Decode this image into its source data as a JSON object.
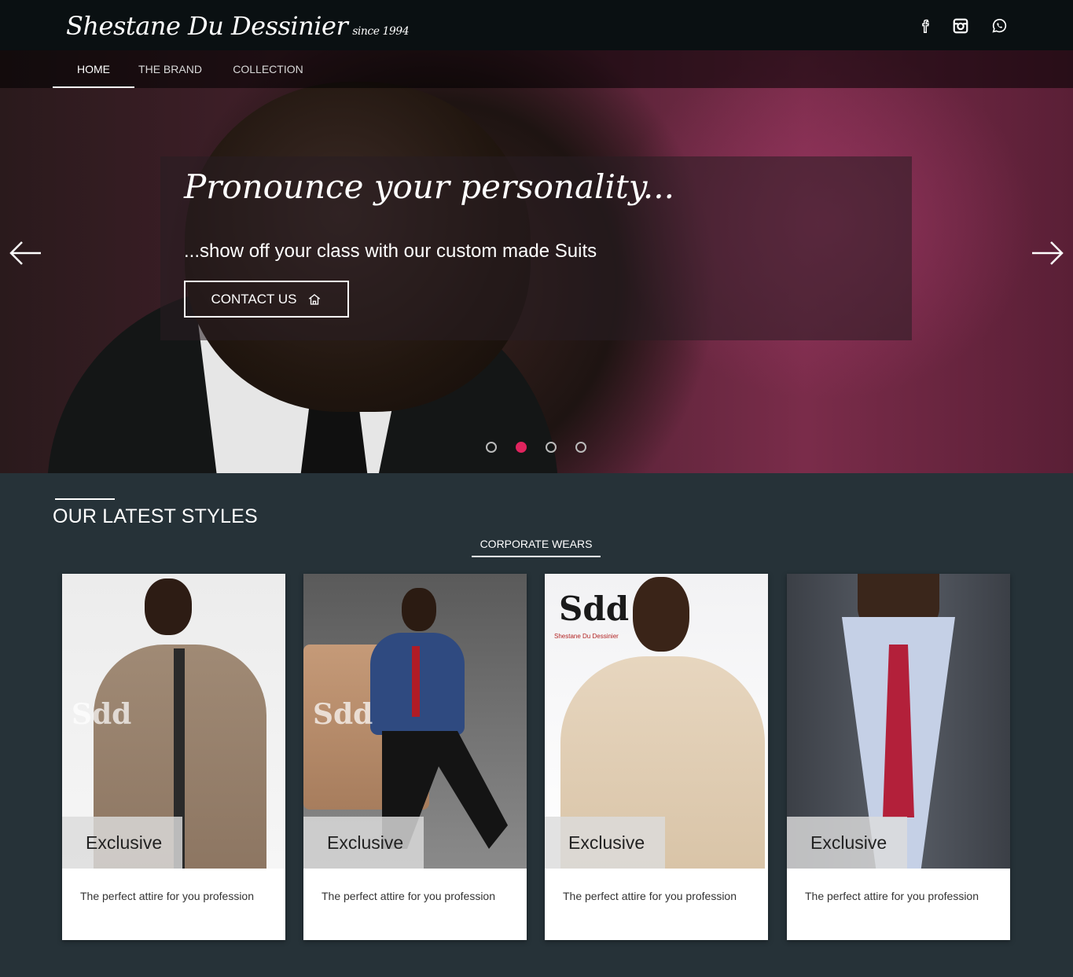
{
  "brand": {
    "name": "Shestane Du Dessinier",
    "since": "since 1994"
  },
  "social": {
    "icons": [
      "facebook-icon",
      "instagram-icon",
      "whatsapp-icon"
    ]
  },
  "nav": {
    "items": [
      "HOME",
      "THE BRAND",
      "COLLECTION"
    ],
    "active": "HOME"
  },
  "hero": {
    "title": "Pronounce your personality...",
    "subtitle": "...show off your class with our custom made Suits",
    "button_label": "CONTACT US",
    "slides": 4,
    "active_slide": 2
  },
  "section": {
    "title": "OUR LATEST STYLES",
    "tab_label": "CORPORATE WEARS"
  },
  "cards": [
    {
      "badge": "Exclusive",
      "description": "The perfect attire for you profession"
    },
    {
      "badge": "Exclusive",
      "description": "The perfect attire for you profession"
    },
    {
      "badge": "Exclusive",
      "description": "The perfect attire for you profession"
    },
    {
      "badge": "Exclusive",
      "description": "The perfect attire for you profession"
    }
  ],
  "card_logo": {
    "mark": "Sdd",
    "name": "Shestane Du Dessinier"
  },
  "colors": {
    "accent": "#e0245e",
    "topbar": "#0a1012",
    "section_bg": "#263238"
  }
}
